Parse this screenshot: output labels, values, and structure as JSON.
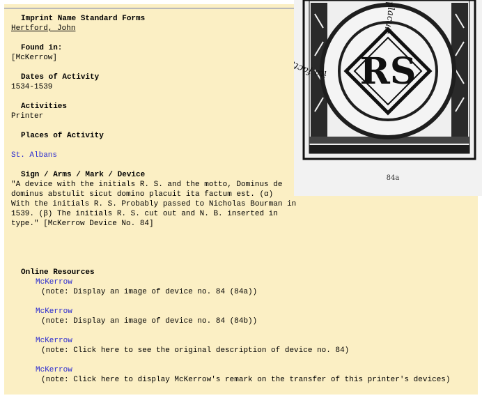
{
  "record": {
    "imprint_heading": "Imprint Name Standard Forms",
    "imprint_name": "Hertford, John",
    "found_in_heading": "Found in:",
    "found_in": "[McKerrow]",
    "dates_heading": "Dates of Activity",
    "dates": "1534-1539",
    "activities_heading": "Activities",
    "activities": "Printer",
    "places_heading": "Places of Activity",
    "place": "St. Albans",
    "sign_heading": "Sign / Arms / Mark / Device",
    "sign_lines": [
      "\"A device with the initials R. S. and the motto, Dominus de",
      "dominus abstulit sicut domino placuit ita factum est. (α)",
      "With the initials R. S. Probably passed to Nicholas Bourman in",
      "1539. (β) The initials R. S. cut out and N. B. inserted in",
      "type.\" [McKerrow Device No. 84]"
    ],
    "resources_heading": "Online Resources",
    "resources": [
      {
        "label": "McKerrow",
        "note": "(note: Display an image of device no. 84 (84a))"
      },
      {
        "label": "McKerrow",
        "note": "(note: Display an image of device no. 84 (84b))"
      },
      {
        "label": "McKerrow",
        "note": "(note: Click here to see the original description of device no. 84)"
      },
      {
        "label": "McKerrow",
        "note": "(note: Click here to display McKerrow's remark on the transfer of this printer's devices)"
      }
    ]
  },
  "device_image": {
    "motto_text": "ita factum est. Dominus dedit dominus abstulit sicut domino placuit",
    "initials": "RS",
    "caption": "84a"
  }
}
